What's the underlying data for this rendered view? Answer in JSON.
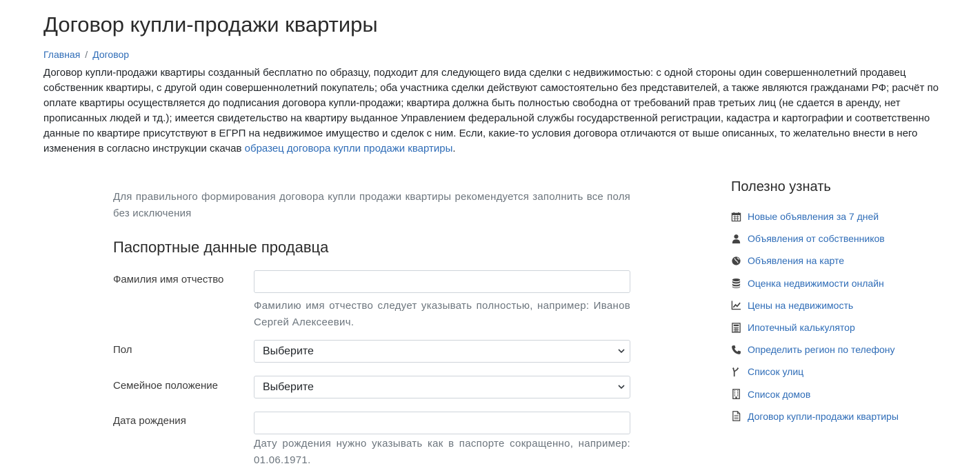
{
  "page": {
    "title": "Договор купли-продажи квартиры"
  },
  "breadcrumb": {
    "home": "Главная",
    "separator": "/",
    "current": "Договор"
  },
  "intro": {
    "text": "Договор купли-продажи квартиры созданный бесплатно по образцу, подходит для следующего вида сделки с недвижимостью: с одной стороны один совершеннолетний продавец собственник квартиры, с другой один совершеннолетний покупатель; оба участника сделки действуют самостоятельно без представителей, а также являются гражданами РФ; расчёт по оплате квартиры осуществляется до подписания договора купли-продажи; квартира должна быть полностью свободна от требований прав третьих лиц (не сдается в аренду, нет прописанных людей и тд.); имеется свидетельство на квартиру выданное Управлением федеральной службы государственной регистрации, кадастра и картографии и соответственно данные по квартире присутствуют в ЕГРП на недвижимое имущество и сделок с ним. Если, какие-то условия договора отличаются от выше описанных, то желательно внести в него изменения в согласно инструкции скачав ",
    "link_text": "образец договора купли продажи квартиры",
    "link_tail": "."
  },
  "form": {
    "hint": "Для правильного формирования договора купли продажи квартиры рекомендуется заполнить все поля без исключения",
    "section_title": "Паспортные данные продавца",
    "fields": {
      "fio": {
        "label": "Фамилия имя отчество",
        "value": "",
        "help": "Фамилию имя отчество следует указывать полностью, например: Иванов Сергей Алексеевич."
      },
      "gender": {
        "label": "Пол",
        "selected": "Выберите"
      },
      "marital": {
        "label": "Семейное положение",
        "selected": "Выберите"
      },
      "birthdate": {
        "label": "Дата рождения",
        "value": "",
        "help": "Дату рождения нужно указывать как в паспорте сокращенно, например: 01.06.1971."
      }
    }
  },
  "sidebar": {
    "title": "Полезно узнать",
    "items": [
      {
        "label": "Новые объявления за 7 дней",
        "icon": "calendar-icon"
      },
      {
        "label": "Объявления от собственников",
        "icon": "user-icon"
      },
      {
        "label": "Объявления на карте",
        "icon": "globe-icon"
      },
      {
        "label": "Оценка недвижимости онлайн",
        "icon": "database-icon"
      },
      {
        "label": "Цены на недвижимость",
        "icon": "line-chart-icon"
      },
      {
        "label": "Ипотечный калькулятор",
        "icon": "calculator-icon"
      },
      {
        "label": "Определить регион по телефону",
        "icon": "phone-icon"
      },
      {
        "label": "Список улиц",
        "icon": "road-fork-icon"
      },
      {
        "label": "Список домов",
        "icon": "building-icon"
      },
      {
        "label": "Договор купли-продажи квартиры",
        "icon": "document-icon"
      }
    ]
  },
  "colors": {
    "link": "#2e6cb7",
    "muted_text": "#6c757d",
    "icon": "#444444",
    "input_border": "#ced4da"
  }
}
